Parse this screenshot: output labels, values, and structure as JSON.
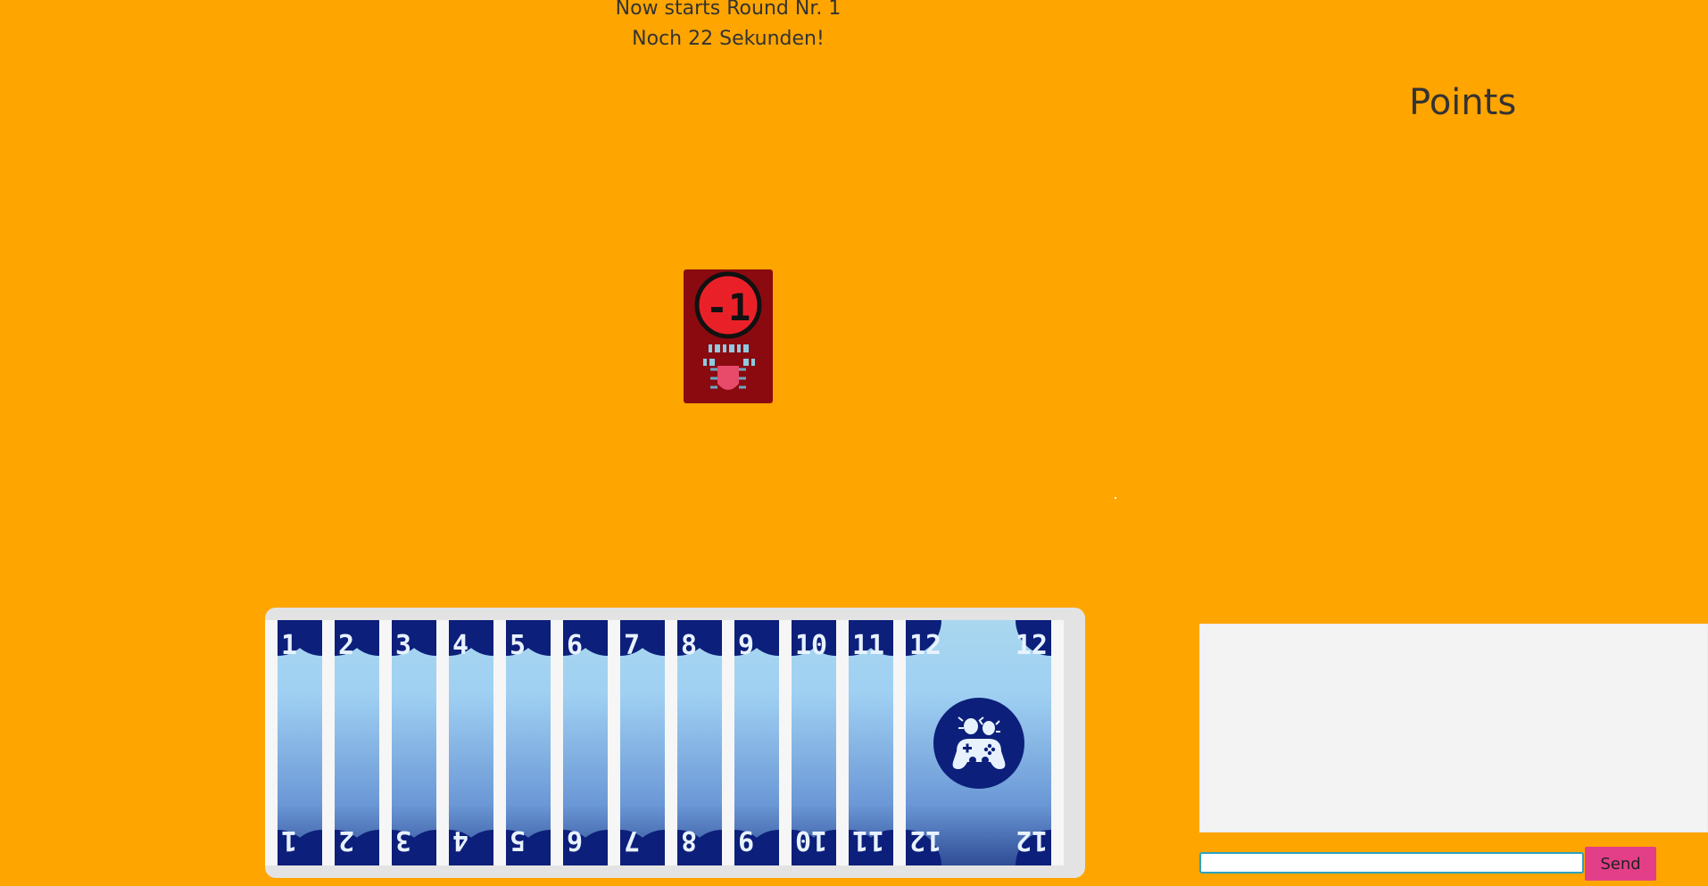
{
  "status": {
    "round_text": "Now starts Round Nr. 1",
    "timer_text": "Noch 22 Sekunden!"
  },
  "points": {
    "title": "Points"
  },
  "played_card": {
    "value": "-1",
    "icon": "bug-icon",
    "color": "#8a0a10"
  },
  "hand": {
    "cards": [
      {
        "value": "1"
      },
      {
        "value": "2"
      },
      {
        "value": "3"
      },
      {
        "value": "4"
      },
      {
        "value": "5"
      },
      {
        "value": "6"
      },
      {
        "value": "7"
      },
      {
        "value": "8"
      },
      {
        "value": "9"
      },
      {
        "value": "10"
      },
      {
        "value": "11"
      },
      {
        "value": "12"
      }
    ],
    "emblem_icon": "gamepad-bugs-icon"
  },
  "chat": {
    "input_value": "",
    "send_label": "Send"
  },
  "colors": {
    "background": "#ffa500",
    "card_navy": "#0c1f7a",
    "send_button": "#e33f88",
    "played_card": "#8a0a10"
  }
}
